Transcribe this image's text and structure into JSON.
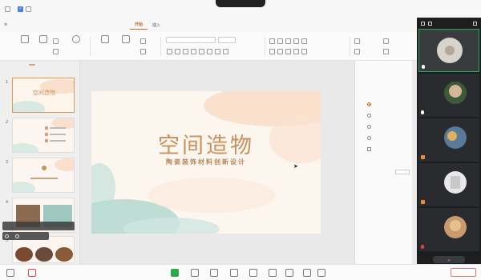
{
  "statusbar": {
    "left_label": "",
    "meeting_pill": "",
    "right_labels": [
      "",
      "",
      "",
      ""
    ]
  },
  "titlebar": {
    "app_tab": "",
    "doc_tab": "",
    "ribbon_tabs": [
      "",
      "开始",
      "插入",
      "",
      "",
      "",
      "",
      "",
      "",
      "",
      "",
      ""
    ],
    "active_tab_index": 1,
    "right_tab": ""
  },
  "ribbon": {
    "buttons": [
      "",
      "",
      "",
      "",
      "",
      "",
      "",
      ""
    ],
    "font_field": "",
    "size_field": ""
  },
  "thumbpanel": {
    "tabs": [
      "",
      ""
    ],
    "slides": [
      {
        "num": "1",
        "title": "空间造物",
        "selected": true
      },
      {
        "num": "2",
        "title": "",
        "selected": false
      },
      {
        "num": "3",
        "title": "",
        "selected": false
      },
      {
        "num": "4",
        "title": "",
        "selected": false
      },
      {
        "num": "5",
        "title": "",
        "selected": false
      }
    ],
    "mini_bar_text": "",
    "mini_bar2_text": ""
  },
  "slide": {
    "title": "空间造物",
    "subtitle": "陶瓷装饰材料创新设计",
    "presenter": "",
    "date": ""
  },
  "proppane": {
    "header": "",
    "tab": "",
    "section": "",
    "options": [
      {
        "label": "",
        "type": "radio",
        "checked": true
      },
      {
        "label": "",
        "type": "radio",
        "checked": false
      },
      {
        "label": "",
        "type": "radio",
        "checked": false
      },
      {
        "label": "",
        "type": "radio",
        "checked": false
      },
      {
        "label": "",
        "type": "checkbox",
        "checked": false
      }
    ],
    "row1": "",
    "row2": ""
  },
  "participants": [
    {
      "name": "",
      "mic": "on",
      "active": true
    },
    {
      "name": "",
      "mic": "on",
      "active": false
    },
    {
      "name": "",
      "mic": "on",
      "active": false
    },
    {
      "name": "",
      "mic": "on",
      "active": false
    },
    {
      "name": "",
      "mic": "off",
      "active": false
    }
  ],
  "bottombar": {
    "end_label": ""
  },
  "colors": {
    "accent": "#c36a2d",
    "slide_title": "#c8915c",
    "video_bg": "#1d1e20",
    "active_green": "#2ea84e",
    "end_red": "#e04343"
  }
}
